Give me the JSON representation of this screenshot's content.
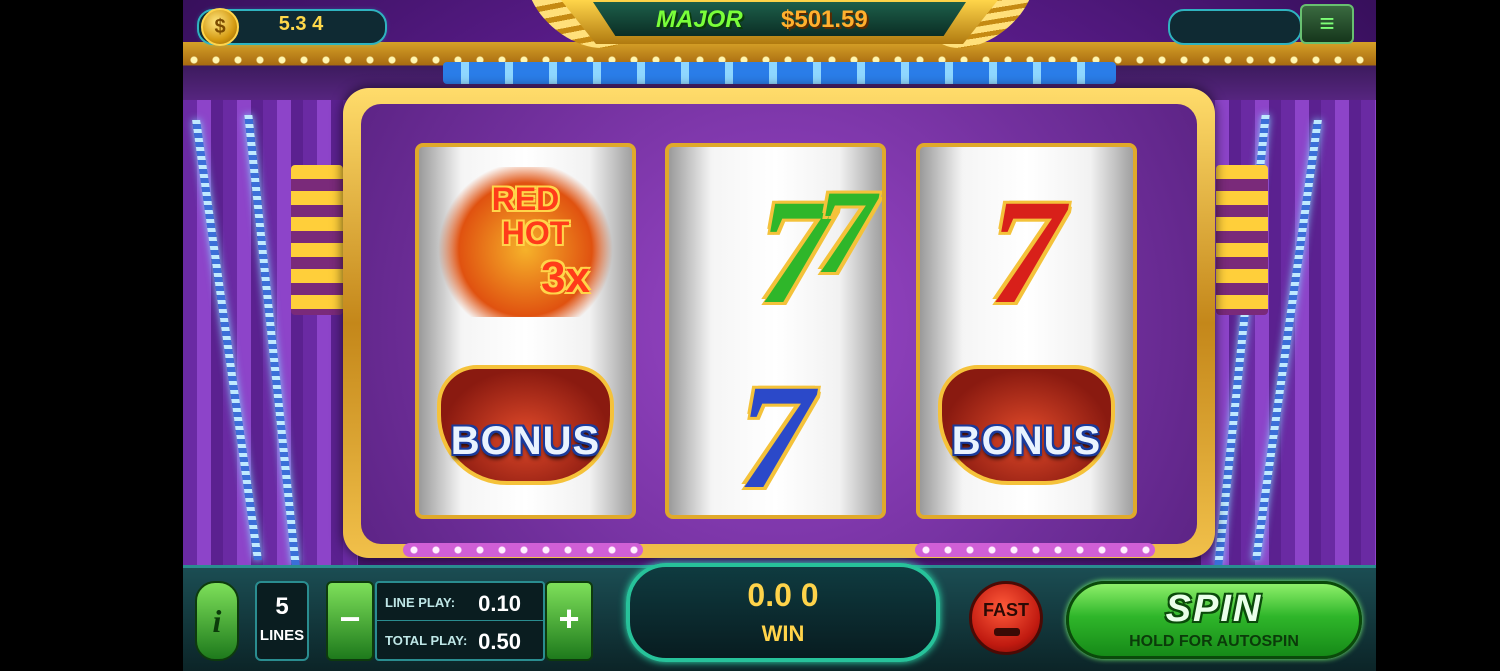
{
  "hud": {
    "balance": "5.3 4",
    "coin_symbol": "$",
    "jackpot_label": "MAJOR",
    "jackpot_value": "$501.59",
    "menu_icon": "≡"
  },
  "reels": [
    {
      "top": {
        "type": "red-hot-3x",
        "line1": "RED",
        "line2": "HOT",
        "line3": "3x"
      },
      "bottom": {
        "type": "bonus",
        "text": "BONUS"
      }
    },
    {
      "top": {
        "type": "double-seven-green",
        "glyph": "7",
        "glyph2": "7"
      },
      "bottom": {
        "type": "seven-blue",
        "glyph": "7"
      }
    },
    {
      "top": {
        "type": "seven-red",
        "glyph": "7"
      },
      "bottom": {
        "type": "bonus",
        "text": "BONUS"
      }
    }
  ],
  "controls": {
    "info_label": "i",
    "lines_value": "5",
    "lines_label": "LINES",
    "minus_label": "−",
    "plus_label": "+",
    "line_play_label": "LINE PLAY:",
    "line_play_value": "0.10",
    "total_play_label": "TOTAL PLAY:",
    "total_play_value": "0.50",
    "win_value": "0.0 0",
    "win_label": "WIN",
    "fast_label": "FAST",
    "spin_label": "SPIN",
    "spin_sub": "HOLD FOR AUTOSPIN"
  },
  "colors": {
    "accent_green": "#2fb62a",
    "gold": "#ffd34a",
    "purple_stage": "#7a2fb0"
  }
}
